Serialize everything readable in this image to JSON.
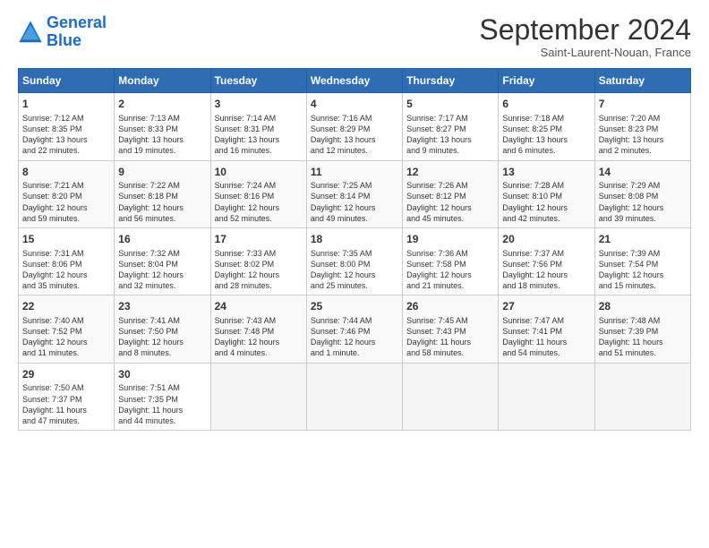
{
  "header": {
    "logo_line1": "General",
    "logo_line2": "Blue",
    "month": "September 2024",
    "location": "Saint-Laurent-Nouan, France"
  },
  "weekdays": [
    "Sunday",
    "Monday",
    "Tuesday",
    "Wednesday",
    "Thursday",
    "Friday",
    "Saturday"
  ],
  "weeks": [
    [
      {
        "day": "1",
        "lines": [
          "Sunrise: 7:12 AM",
          "Sunset: 8:35 PM",
          "Daylight: 13 hours",
          "and 22 minutes."
        ]
      },
      {
        "day": "2",
        "lines": [
          "Sunrise: 7:13 AM",
          "Sunset: 8:33 PM",
          "Daylight: 13 hours",
          "and 19 minutes."
        ]
      },
      {
        "day": "3",
        "lines": [
          "Sunrise: 7:14 AM",
          "Sunset: 8:31 PM",
          "Daylight: 13 hours",
          "and 16 minutes."
        ]
      },
      {
        "day": "4",
        "lines": [
          "Sunrise: 7:16 AM",
          "Sunset: 8:29 PM",
          "Daylight: 13 hours",
          "and 12 minutes."
        ]
      },
      {
        "day": "5",
        "lines": [
          "Sunrise: 7:17 AM",
          "Sunset: 8:27 PM",
          "Daylight: 13 hours",
          "and 9 minutes."
        ]
      },
      {
        "day": "6",
        "lines": [
          "Sunrise: 7:18 AM",
          "Sunset: 8:25 PM",
          "Daylight: 13 hours",
          "and 6 minutes."
        ]
      },
      {
        "day": "7",
        "lines": [
          "Sunrise: 7:20 AM",
          "Sunset: 8:23 PM",
          "Daylight: 13 hours",
          "and 2 minutes."
        ]
      }
    ],
    [
      {
        "day": "8",
        "lines": [
          "Sunrise: 7:21 AM",
          "Sunset: 8:20 PM",
          "Daylight: 12 hours",
          "and 59 minutes."
        ]
      },
      {
        "day": "9",
        "lines": [
          "Sunrise: 7:22 AM",
          "Sunset: 8:18 PM",
          "Daylight: 12 hours",
          "and 56 minutes."
        ]
      },
      {
        "day": "10",
        "lines": [
          "Sunrise: 7:24 AM",
          "Sunset: 8:16 PM",
          "Daylight: 12 hours",
          "and 52 minutes."
        ]
      },
      {
        "day": "11",
        "lines": [
          "Sunrise: 7:25 AM",
          "Sunset: 8:14 PM",
          "Daylight: 12 hours",
          "and 49 minutes."
        ]
      },
      {
        "day": "12",
        "lines": [
          "Sunrise: 7:26 AM",
          "Sunset: 8:12 PM",
          "Daylight: 12 hours",
          "and 45 minutes."
        ]
      },
      {
        "day": "13",
        "lines": [
          "Sunrise: 7:28 AM",
          "Sunset: 8:10 PM",
          "Daylight: 12 hours",
          "and 42 minutes."
        ]
      },
      {
        "day": "14",
        "lines": [
          "Sunrise: 7:29 AM",
          "Sunset: 8:08 PM",
          "Daylight: 12 hours",
          "and 39 minutes."
        ]
      }
    ],
    [
      {
        "day": "15",
        "lines": [
          "Sunrise: 7:31 AM",
          "Sunset: 8:06 PM",
          "Daylight: 12 hours",
          "and 35 minutes."
        ]
      },
      {
        "day": "16",
        "lines": [
          "Sunrise: 7:32 AM",
          "Sunset: 8:04 PM",
          "Daylight: 12 hours",
          "and 32 minutes."
        ]
      },
      {
        "day": "17",
        "lines": [
          "Sunrise: 7:33 AM",
          "Sunset: 8:02 PM",
          "Daylight: 12 hours",
          "and 28 minutes."
        ]
      },
      {
        "day": "18",
        "lines": [
          "Sunrise: 7:35 AM",
          "Sunset: 8:00 PM",
          "Daylight: 12 hours",
          "and 25 minutes."
        ]
      },
      {
        "day": "19",
        "lines": [
          "Sunrise: 7:36 AM",
          "Sunset: 7:58 PM",
          "Daylight: 12 hours",
          "and 21 minutes."
        ]
      },
      {
        "day": "20",
        "lines": [
          "Sunrise: 7:37 AM",
          "Sunset: 7:56 PM",
          "Daylight: 12 hours",
          "and 18 minutes."
        ]
      },
      {
        "day": "21",
        "lines": [
          "Sunrise: 7:39 AM",
          "Sunset: 7:54 PM",
          "Daylight: 12 hours",
          "and 15 minutes."
        ]
      }
    ],
    [
      {
        "day": "22",
        "lines": [
          "Sunrise: 7:40 AM",
          "Sunset: 7:52 PM",
          "Daylight: 12 hours",
          "and 11 minutes."
        ]
      },
      {
        "day": "23",
        "lines": [
          "Sunrise: 7:41 AM",
          "Sunset: 7:50 PM",
          "Daylight: 12 hours",
          "and 8 minutes."
        ]
      },
      {
        "day": "24",
        "lines": [
          "Sunrise: 7:43 AM",
          "Sunset: 7:48 PM",
          "Daylight: 12 hours",
          "and 4 minutes."
        ]
      },
      {
        "day": "25",
        "lines": [
          "Sunrise: 7:44 AM",
          "Sunset: 7:46 PM",
          "Daylight: 12 hours",
          "and 1 minute."
        ]
      },
      {
        "day": "26",
        "lines": [
          "Sunrise: 7:45 AM",
          "Sunset: 7:43 PM",
          "Daylight: 11 hours",
          "and 58 minutes."
        ]
      },
      {
        "day": "27",
        "lines": [
          "Sunrise: 7:47 AM",
          "Sunset: 7:41 PM",
          "Daylight: 11 hours",
          "and 54 minutes."
        ]
      },
      {
        "day": "28",
        "lines": [
          "Sunrise: 7:48 AM",
          "Sunset: 7:39 PM",
          "Daylight: 11 hours",
          "and 51 minutes."
        ]
      }
    ],
    [
      {
        "day": "29",
        "lines": [
          "Sunrise: 7:50 AM",
          "Sunset: 7:37 PM",
          "Daylight: 11 hours",
          "and 47 minutes."
        ]
      },
      {
        "day": "30",
        "lines": [
          "Sunrise: 7:51 AM",
          "Sunset: 7:35 PM",
          "Daylight: 11 hours",
          "and 44 minutes."
        ]
      },
      {
        "day": "",
        "lines": []
      },
      {
        "day": "",
        "lines": []
      },
      {
        "day": "",
        "lines": []
      },
      {
        "day": "",
        "lines": []
      },
      {
        "day": "",
        "lines": []
      }
    ]
  ]
}
